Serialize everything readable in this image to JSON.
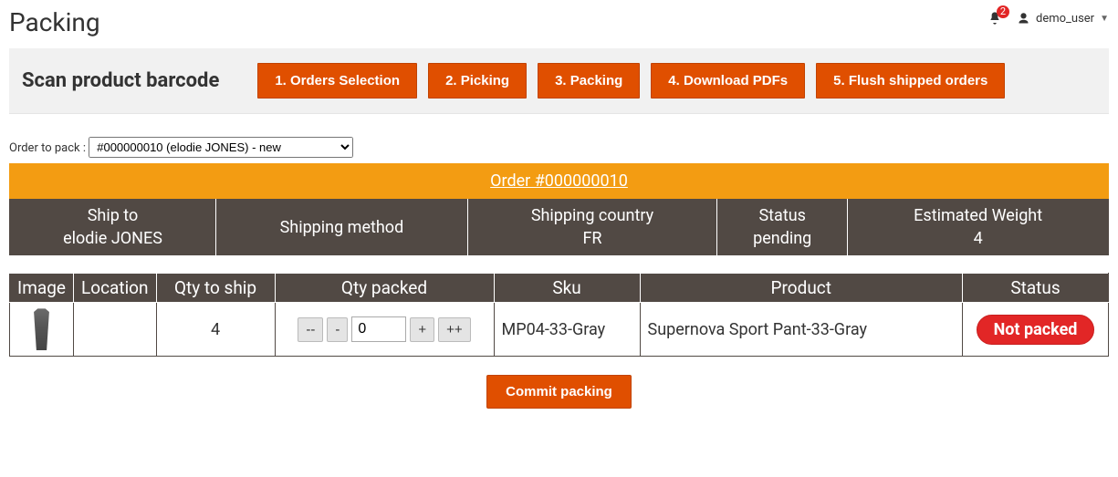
{
  "title": "Packing",
  "notifications_count": "2",
  "user_name": "demo_user",
  "action_bar": {
    "scan_label": "Scan product barcode",
    "steps": [
      "1. Orders Selection",
      "2. Picking",
      "3. Packing",
      "4. Download PDFs",
      "5. Flush shipped orders"
    ]
  },
  "order_select": {
    "label": "Order to pack :",
    "selected": "#000000010 (elodie JONES) - new"
  },
  "summary": {
    "order_link": "Order #000000010",
    "cells": [
      {
        "label": "Ship to",
        "value": "elodie JONES"
      },
      {
        "label": "Shipping method",
        "value": ""
      },
      {
        "label": "Shipping country",
        "value": "FR"
      },
      {
        "label": "Status",
        "value": "pending"
      },
      {
        "label": "Estimated Weight",
        "value": "4"
      }
    ]
  },
  "items_table": {
    "headers": [
      "Image",
      "Location",
      "Qty to ship",
      "Qty packed",
      "Sku",
      "Product",
      "Status"
    ],
    "row": {
      "location": "",
      "qty_to_ship": "4",
      "qty_packed": "0",
      "sku": "MP04-33-Gray",
      "product": "Supernova Sport Pant-33-Gray",
      "status": "Not packed"
    },
    "qty_buttons": {
      "dec2": "--",
      "dec1": "-",
      "inc1": "+",
      "inc2": "++"
    }
  },
  "commit_label": "Commit packing"
}
